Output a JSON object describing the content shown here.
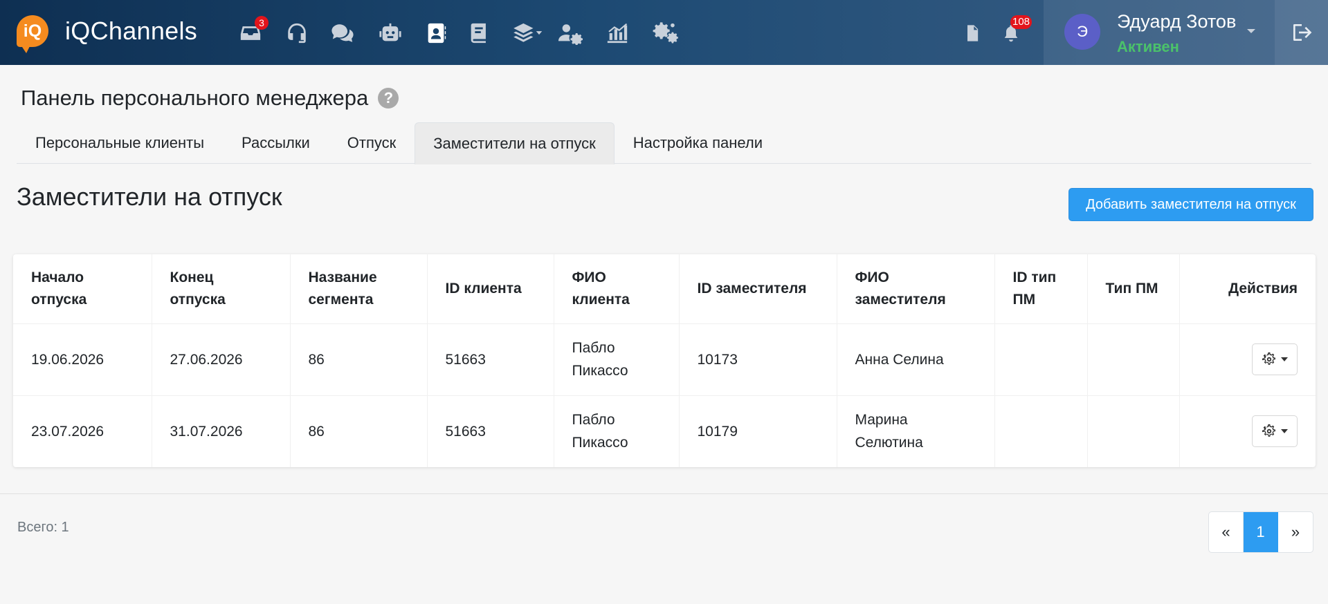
{
  "app": {
    "brand_name": "iQChannels",
    "logo_text": "iQ"
  },
  "nav": {
    "icons": [
      {
        "name": "inbox-icon",
        "badge": "3"
      },
      {
        "name": "headset-icon"
      },
      {
        "name": "chat-icon"
      },
      {
        "name": "robot-icon"
      },
      {
        "name": "contacts-icon",
        "active": true
      },
      {
        "name": "book-icon"
      },
      {
        "name": "layers-icon"
      },
      {
        "name": "users-settings-icon"
      },
      {
        "name": "analytics-icon"
      },
      {
        "name": "settings-icon"
      }
    ],
    "notifications_badge": "108"
  },
  "user": {
    "avatar_letter": "Э",
    "name": "Эдуард Зотов",
    "status": "Активен"
  },
  "colors": {
    "accent": "#2d9cf1",
    "status_active": "#4bc26a",
    "badge": "#e3141b",
    "avatar": "#5b5fc7",
    "logo": "#f58b1f"
  },
  "page": {
    "title": "Панель персонального менеджера",
    "help": "?"
  },
  "tabs": [
    {
      "label": "Персональные клиенты"
    },
    {
      "label": "Рассылки"
    },
    {
      "label": "Отпуск"
    },
    {
      "label": "Заместители на отпуск",
      "active": true
    },
    {
      "label": "Настройка панели"
    }
  ],
  "section": {
    "title": "Заместители на отпуск",
    "add_button": "Добавить заместителя на отпуск"
  },
  "table": {
    "headers": [
      "Начало отпуска",
      "Конец отпуска",
      "Название сегмента",
      "ID клиента",
      "ФИО клиента",
      "ID заместителя",
      "ФИО заместителя",
      "ID тип ПМ",
      "Тип ПМ",
      "Действия"
    ],
    "rows": [
      [
        "19.06.2026",
        "27.06.2026",
        "86",
        "51663",
        "Пабло Пикассо",
        "10173",
        "Анна Селина",
        "",
        ""
      ],
      [
        "23.07.2026",
        "31.07.2026",
        "86",
        "51663",
        "Пабло Пикассо",
        "10179",
        "Марина Селютина",
        "",
        ""
      ]
    ]
  },
  "footer": {
    "total": "Всего: 1",
    "pagination": {
      "prev": "«",
      "current": "1",
      "next": "»"
    }
  }
}
